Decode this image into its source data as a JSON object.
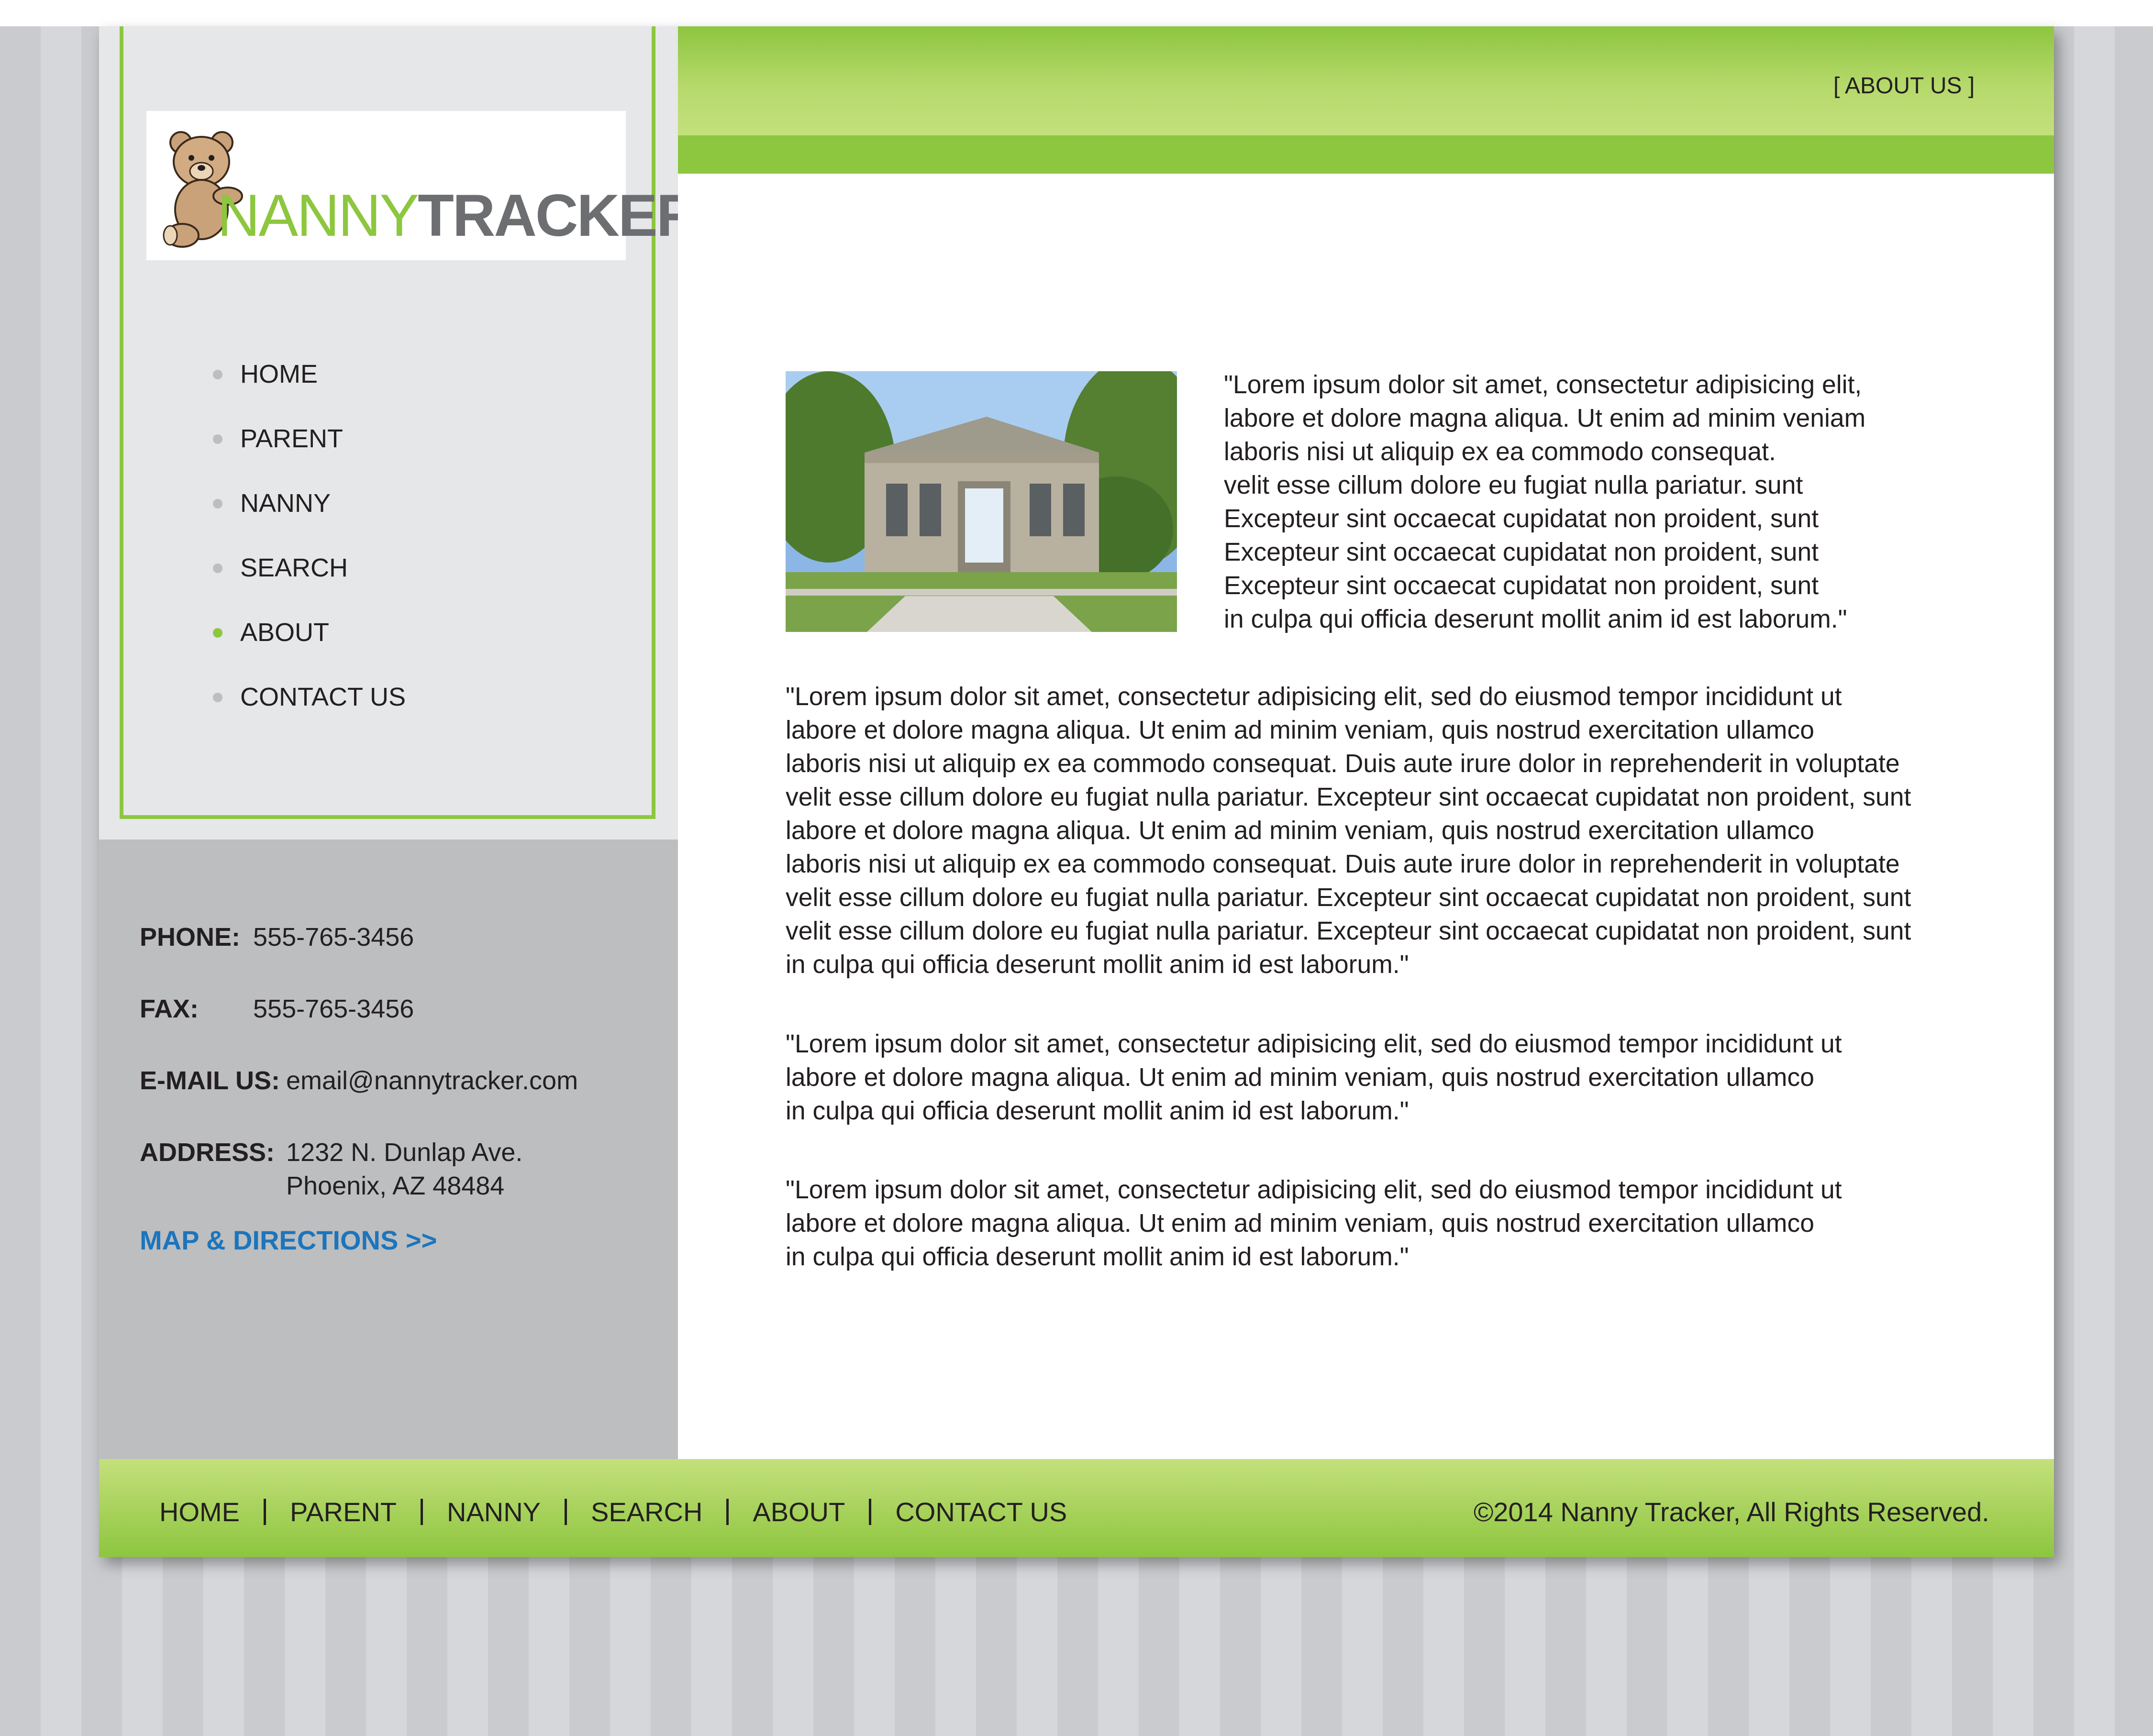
{
  "logo": {
    "nanny": "NANNY",
    "tracker": "TRACKER"
  },
  "header": {
    "about_label": "[  ABOUT US ]"
  },
  "sidebar": {
    "nav": [
      {
        "label": "HOME",
        "active": false
      },
      {
        "label": "PARENT",
        "active": false
      },
      {
        "label": "NANNY",
        "active": false
      },
      {
        "label": "SEARCH",
        "active": false
      },
      {
        "label": "ABOUT",
        "active": true
      },
      {
        "label": "CONTACT US",
        "active": false
      }
    ],
    "contact": {
      "phone_label": "PHONE:",
      "phone": "555-765-3456",
      "fax_label": "FAX:",
      "fax": "555-765-3456",
      "email_label": "E-MAIL US:",
      "email": "email@nannytracker.com",
      "address_label": "ADDRESS:",
      "address_line1": "1232 N. Dunlap Ave.",
      "address_line2": "Phoenix, AZ 48484",
      "map_link": "MAP & DIRECTIONS >>"
    }
  },
  "content": {
    "intro": "\"Lorem ipsum dolor sit amet, consectetur adipisicing elit,\nlabore et dolore magna aliqua. Ut enim ad minim veniam\nlaboris nisi ut aliquip ex ea commodo consequat.\nvelit esse cillum dolore eu fugiat nulla pariatur. sunt\nExcepteur sint occaecat cupidatat non proident, sunt\nExcepteur sint occaecat cupidatat non proident, sunt\nExcepteur sint occaecat cupidatat non proident, sunt\nin culpa qui officia deserunt mollit anim id est laborum.\"",
    "paragraph1": "\"Lorem ipsum dolor sit amet, consectetur adipisicing elit, sed do eiusmod tempor incididunt ut\nlabore et dolore magna aliqua. Ut enim ad minim veniam, quis nostrud exercitation ullamco\nlaboris nisi ut aliquip ex ea commodo consequat. Duis aute irure dolor in reprehenderit in voluptate\nvelit esse cillum dolore eu fugiat nulla pariatur. Excepteur sint occaecat cupidatat non proident, sunt\nlabore et dolore magna aliqua. Ut enim ad minim veniam, quis nostrud exercitation ullamco\nlaboris nisi ut aliquip ex ea commodo consequat. Duis aute irure dolor in reprehenderit in voluptate\nvelit esse cillum dolore eu fugiat nulla pariatur. Excepteur sint occaecat cupidatat non proident, sunt\nvelit esse cillum dolore eu fugiat nulla pariatur. Excepteur sint occaecat cupidatat non proident, sunt\nin culpa qui officia deserunt mollit anim id est laborum.\"",
    "paragraph2": "\"Lorem ipsum dolor sit amet, consectetur adipisicing elit, sed do eiusmod tempor incididunt ut\nlabore et dolore magna aliqua. Ut enim ad minim veniam, quis nostrud exercitation ullamco\nin culpa qui officia deserunt mollit anim id est laborum.\"",
    "paragraph3": "\"Lorem ipsum dolor sit amet, consectetur adipisicing elit, sed do eiusmod tempor incididunt ut\nlabore et dolore magna aliqua. Ut enim ad minim veniam, quis nostrud exercitation ullamco\nin culpa qui officia deserunt mollit anim id est laborum.\""
  },
  "footer": {
    "links": [
      "HOME",
      "PARENT",
      "NANNY",
      "SEARCH",
      "ABOUT",
      "CONTACT US"
    ],
    "copyright": "©2014 Nanny Tracker, All Rights Reserved."
  },
  "colors": {
    "brand_green": "#8dc63f",
    "light_green": "#c4e07c",
    "sidebar_light": "#e6e7e8",
    "sidebar_dark": "#bcbec0",
    "link_blue": "#1c75bc",
    "logo_gray": "#6d6e71"
  },
  "icons": [
    "teddy-bear-logo-icon",
    "bullet-icon"
  ]
}
